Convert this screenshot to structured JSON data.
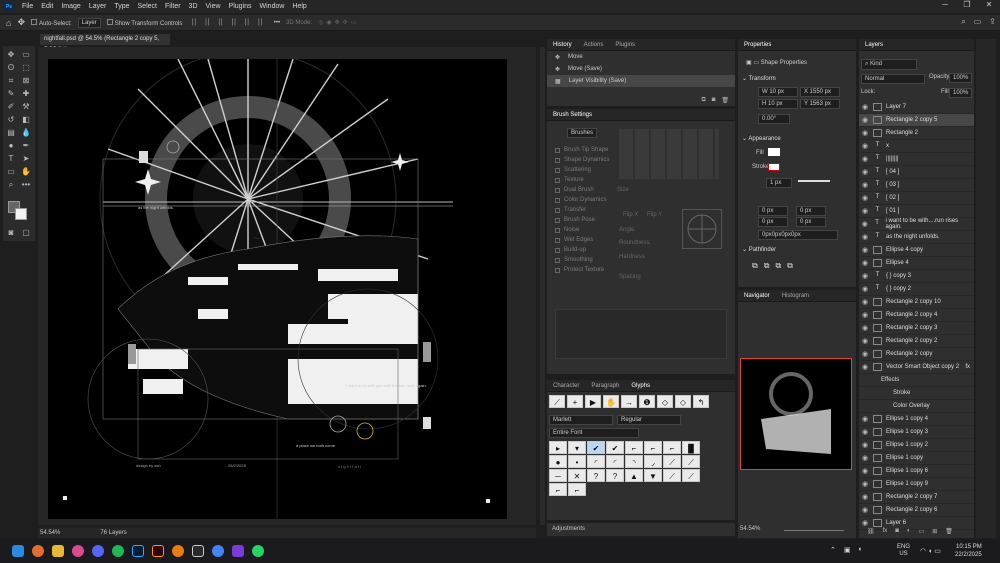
{
  "menu": {
    "items": [
      "File",
      "Edit",
      "Image",
      "Layer",
      "Type",
      "Select",
      "Filter",
      "3D",
      "View",
      "Plugins",
      "Window",
      "Help"
    ]
  },
  "options": {
    "auto_select": "Auto-Select:",
    "layer_dd": "Layer",
    "transform_controls": "Show Transform Controls",
    "mode_3d": "3D Mode:"
  },
  "document": {
    "tab_title": "nightfall.psd @ 54.5% (Rectangle 2 copy 5, RGB/8#)",
    "zoom": "54.54%",
    "layers_count": "76 Layers"
  },
  "art_text": {
    "line1": "as the night unfolds.",
    "line2": "I want to be with you until the sun rises again.",
    "line3": "a place we both come",
    "line4": "n i g h t f a l l",
    "line5": "design by ash",
    "line6": "26/2/2025"
  },
  "history": {
    "tabs": [
      "History",
      "Actions",
      "Plugins"
    ],
    "items": [
      "Move",
      "Move (Save)",
      "Layer Visibility (Save)"
    ]
  },
  "brush": {
    "title": "Brush Settings",
    "brushes_btn": "Brushes",
    "options": [
      "Brush Tip Shape",
      "Shape Dynamics",
      "Scattering",
      "Texture",
      "Dual Brush",
      "Color Dynamics",
      "Transfer",
      "Brush Pose",
      "Noise",
      "Wet Edges",
      "Build-up",
      "Smoothing",
      "Protect Texture"
    ],
    "size": "Size",
    "flipx": "Flip X",
    "flipy": "Flip Y",
    "angle": "Angle:",
    "roundness": "Roundness:",
    "hardness": "Hardness",
    "spacing": "Spacing"
  },
  "glyphs": {
    "tabs": [
      "Character",
      "Paragraph",
      "Glyphs"
    ],
    "font": "Marlett",
    "style": "Regular",
    "filter": "Entire Font",
    "row1": [
      "⟋",
      "+",
      "▶",
      "✋",
      "→",
      "❶",
      "◇",
      "◇",
      "↰"
    ],
    "grid": [
      "▸",
      "▾",
      "✔",
      "✔",
      "⌐",
      "⌐",
      "⌐",
      "█",
      "●",
      "•",
      "◜",
      "◜",
      "◝",
      "◞",
      "⟋",
      "⟋",
      "─",
      "✕",
      "?",
      "?",
      "▲",
      "▼",
      "⟋",
      "⟋",
      "⌐",
      "⌐"
    ]
  },
  "adjustments": "Adjustments",
  "properties": {
    "title": "Properties",
    "sub": "Shape Properties",
    "transform": "Transform",
    "w": "10 px",
    "x": "1550 px",
    "h": "10 px",
    "y": "1563 px",
    "angle": "0.00°",
    "appearance": "Appearance",
    "fill": "Fill",
    "stroke": "Stroke",
    "stroke_w": "1 px",
    "r1": "0 px",
    "r2": "0 px",
    "r3": "0 px",
    "r4": "0 px",
    "radius_all": "0px0px0px0px",
    "pathfinder": "Pathfinder"
  },
  "navigator": {
    "tabs": [
      "Navigator",
      "Histogram"
    ],
    "zoom": "54.54%"
  },
  "layers": {
    "title": "Layers",
    "kind": "Kind",
    "blend": "Normal",
    "opacity_label": "Opacity:",
    "opacity": "100%",
    "lock_label": "Lock:",
    "fill_label": "Fill:",
    "fill": "100%",
    "rows": [
      "Layer 7",
      "Rectangle 2 copy 5",
      "Rectangle 2",
      "x",
      "||||||||",
      "[ 04 ]",
      "[ 03 ]",
      "[ 02 ]",
      "[ 01 ]",
      "i want to be with....run rises again.",
      "as the night unfolds.",
      "Ellipse 4 copy",
      "Ellipse 4",
      "{                    } copy 3",
      "{                    } copy 2",
      "Rectangle 2 copy 10",
      "Rectangle 2 copy 4",
      "Rectangle 2 copy 3",
      "Rectangle 2 copy 2",
      "Rectangle 2 copy",
      "Vector Smart Object copy 2",
      "Effects",
      "Stroke",
      "Color Overlay",
      "Ellipse 1 copy 4",
      "Ellipse 1 copy 3",
      "Ellipse 1 copy 2",
      "Ellipse 1 copy",
      "Ellipse 1 copy 6",
      "Ellipse 1 copy 9",
      "Rectangle 2 copy 7",
      "Rectangle 2 copy 6",
      "Layer 6"
    ]
  },
  "taskbar": {
    "lang1": "ENG",
    "lang2": "US",
    "time": "10:15 PM",
    "date": "22/2/2025"
  },
  "colors": {
    "accent": "#31a8ff",
    "nav_frame": "#e0443a"
  }
}
